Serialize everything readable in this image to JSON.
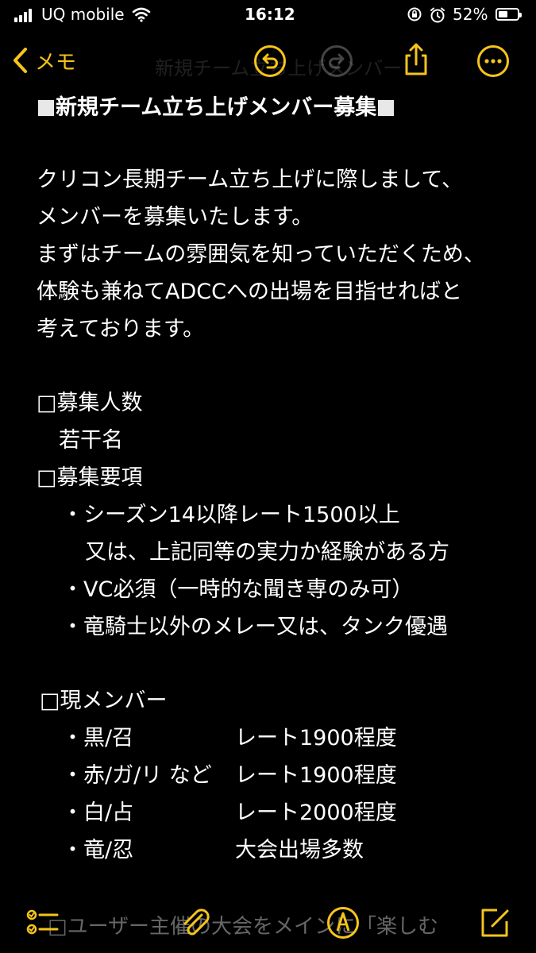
{
  "status_bar": {
    "carrier": "UQ mobile",
    "time": "16:12",
    "battery_percent": "52%",
    "battery_level": 0.52,
    "icons": [
      "signal-icon",
      "wifi-icon",
      "orientation-lock-icon",
      "alarm-icon",
      "battery-icon"
    ]
  },
  "nav": {
    "back_label": "メモ",
    "faded_title": "新規チーム立ち上げメンバー",
    "accent_color": "#f6c41a",
    "icons": [
      "chevron-left-icon",
      "undo-icon",
      "redo-icon",
      "share-icon",
      "more-icon"
    ]
  },
  "note": {
    "title": "新規チーム立ち上げメンバー募集",
    "intro": [
      "クリコン長期チーム立ち上げに際しまして、",
      "メンバーを募集いたします。",
      "まずはチームの雰囲気を知っていただくため、",
      "体験も兼ねてADCCへの出場を目指せればと",
      "考えております。"
    ],
    "section_count_heading": "募集人数",
    "section_count_value": "若干名",
    "section_req_heading": "募集要項",
    "req_1": "・シーズン14以降レート1500以上",
    "req_1_cont": "又は、上記同等の実力か経験がある方",
    "req_2": "・VC必須（一時的な聞き専のみ可）",
    "req_3": "・竜騎士以外のメレー又は、タンク優遇",
    "section_members_heading": "現メンバー",
    "members": [
      {
        "role": "・黒/召",
        "note": "レート1900程度"
      },
      {
        "role": "・赤/ガ/リ など",
        "note": "レート1900程度"
      },
      {
        "role": "・白/占",
        "note": "レート2000程度"
      },
      {
        "role": "・竜/忍",
        "note": "大会出場多数"
      }
    ]
  },
  "bottom_toolbar": {
    "faded_text": "□ユーザー主催の大会をメインに「楽しむ",
    "icons": [
      "checklist-icon",
      "attachment-icon",
      "markup-icon",
      "compose-icon"
    ]
  }
}
